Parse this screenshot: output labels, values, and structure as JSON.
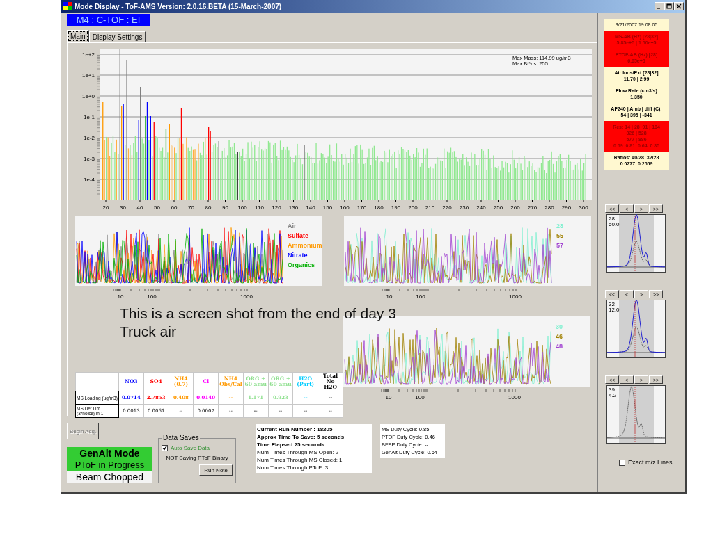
{
  "window": {
    "title": "Mode Display - ToF-AMS Version: 2.0.16.BETA (15-March-2007)"
  },
  "mode_label": "M4 : C-TOF : EI",
  "tabs": [
    {
      "label": "Main",
      "selected": true
    },
    {
      "label": "Display Settings",
      "selected": false
    }
  ],
  "spectrum": {
    "y_tick_labels": [
      "1e+2",
      "1e+1",
      "1e+0",
      "1e-1",
      "1e-2",
      "1e-3",
      "1e-4"
    ],
    "x_tick_labels": [
      "20",
      "30",
      "40",
      "50",
      "60",
      "70",
      "80",
      "90",
      "100",
      "110",
      "120",
      "130",
      "140",
      "150",
      "160",
      "170",
      "180",
      "190",
      "200",
      "210",
      "220",
      "230",
      "240",
      "250",
      "260",
      "270",
      "280",
      "290",
      "300"
    ],
    "max_mass": "Max Mass: 114.99 ug/m3",
    "max_btns": "Max Bt*ns: 255"
  },
  "time_series": [
    {
      "x_tick_labels": [
        "10",
        "100",
        "1000"
      ],
      "legend": [
        {
          "label": "Air",
          "color": "#808080"
        },
        {
          "label": "Sulfate",
          "color": "#ff0000"
        },
        {
          "label": "Ammonium",
          "color": "#ff9900"
        },
        {
          "label": "Nitrate",
          "color": "#0000ff"
        },
        {
          "label": "Organics",
          "color": "#00b000"
        }
      ]
    },
    {
      "x_tick_labels": [
        "10",
        "100",
        "1000"
      ],
      "legend": [
        {
          "label": "28",
          "color": "#80f0d0"
        },
        {
          "label": "55",
          "color": "#a08000"
        },
        {
          "label": "57",
          "color": "#a040d0"
        }
      ]
    },
    {
      "x_tick_labels": [
        "10",
        "100",
        "1000"
      ],
      "legend": [
        {
          "label": "30",
          "color": "#80f0d0"
        },
        {
          "label": "46",
          "color": "#a08000"
        },
        {
          "label": "48",
          "color": "#a040d0"
        }
      ]
    }
  ],
  "annotation": "This is a screen shot from the end of day 3\nTruck air",
  "loading_table": {
    "columns": [
      {
        "label": "NO3",
        "color": "#0000ff"
      },
      {
        "label": "SO4",
        "color": "#ff0000"
      },
      {
        "label": "NH4 (0.7)",
        "color": "#ff9900"
      },
      {
        "label": "Cl",
        "color": "#ff00ff"
      },
      {
        "label": "NH4 Obs/Cal",
        "color": "#ff9900"
      },
      {
        "label": "ORG + 60 amu",
        "color": "#90e090"
      },
      {
        "label": "ORG + 60 amu",
        "color": "#90e090"
      },
      {
        "label": "H2O (Part)",
        "color": "#00ccff"
      },
      {
        "label": "Total No H2O",
        "color": "#000000"
      }
    ],
    "rows": [
      {
        "label": "MS Loading (ug/m3)",
        "colored": true,
        "cells": [
          "0.0714",
          "2.7853",
          "0.408",
          "0.0140",
          "--",
          "1.171",
          "0.923",
          "--",
          "--"
        ]
      },
      {
        "label": "MS Det Lim (3*noise) in 1",
        "colored": false,
        "cells": [
          "0.0013",
          "0.0061",
          "--",
          "0.0007",
          "--",
          "--",
          "--",
          "--",
          "--"
        ]
      }
    ]
  },
  "begin_button": {
    "label": "Begin Acq.",
    "disabled": true
  },
  "mode_status": [
    {
      "text": "GenAlt Mode",
      "color": "#33cc33"
    },
    {
      "text": "PToF in Progress",
      "color": "#33cc33"
    },
    {
      "text": "Beam Chopped",
      "color": "#f4f4f4"
    }
  ],
  "data_saves": {
    "title": "Data Saves",
    "auto_save": {
      "label": "Auto Save Data",
      "checked": true
    },
    "binary_status": "NOT Saving PToF Binary",
    "run_note_button": "Run Note"
  },
  "run_info": [
    {
      "text": "Current Run Number : 18205",
      "emphasis": true
    },
    {
      "text": "Approx Time To Save: 5 seconds",
      "emphasis": true
    },
    {
      "text": "Time Elapsed 25 seconds",
      "emphasis": true
    },
    {
      "text": "Num Times Through MS Open: 2",
      "emphasis": false
    },
    {
      "text": "Num Times Through MS Closed: 1",
      "emphasis": false
    },
    {
      "text": "Num Times Through PToF: 3",
      "emphasis": false
    }
  ],
  "duty_cycles": [
    "MS Duty Cycle: 0.85",
    "PTOF Duty Cycle: 0.46",
    "BFSP Duty Cycle: --",
    "GenAlt Duty Cycle: 0.64"
  ],
  "status_panel": [
    {
      "kind": "timestamp",
      "alert": false,
      "lines": [
        "3/21/2007 19:08:05"
      ]
    },
    {
      "kind": "reading",
      "alert": true,
      "lines": [
        "MS-AB (Hz) [28|32]",
        "5.85e+5 | 1.50e+5"
      ]
    },
    {
      "kind": "reading",
      "alert": true,
      "lines": [
        "PTOF-AB (Hz) [28]",
        "6.65e+5"
      ]
    },
    {
      "kind": "reading",
      "alert": false,
      "lines": [
        "Air Ions/Ext [28|32]",
        "11.70 | 2.99"
      ]
    },
    {
      "kind": "reading",
      "alert": false,
      "lines": [
        "Flow Rate (cm3/s)",
        "1.350"
      ]
    },
    {
      "kind": "reading",
      "alert": false,
      "lines": [
        "AP240 | Amb | diff (C):",
        "54 | 395 | -341"
      ]
    },
    {
      "kind": "reading",
      "alert": true,
      "lines": [
        "Res: 14 | 28  91 | 184",
        "326 | 528",
        "577 | 886",
        "0.69  0.81  0.64  0.85"
      ]
    },
    {
      "kind": "reading",
      "alert": false,
      "lines": [
        "Ratios: 40/28  32/28",
        "0.0277  0.2559"
      ]
    }
  ],
  "peak_monitors": [
    {
      "buttons": [
        "<<",
        "<",
        ">",
        ">>"
      ],
      "mass": "28",
      "value": "50.0",
      "measured_trace": true
    },
    {
      "buttons": [
        "<<",
        "<",
        ">",
        ">>"
      ],
      "mass": "32",
      "value": "12.0",
      "measured_trace": true
    },
    {
      "buttons": [
        "<<",
        "<",
        ">",
        ">>"
      ],
      "mass": "39",
      "value": "4.2",
      "measured_trace": false
    }
  ],
  "exact_mz_lines": {
    "label": "Exact m/z Lines",
    "checked": false
  }
}
